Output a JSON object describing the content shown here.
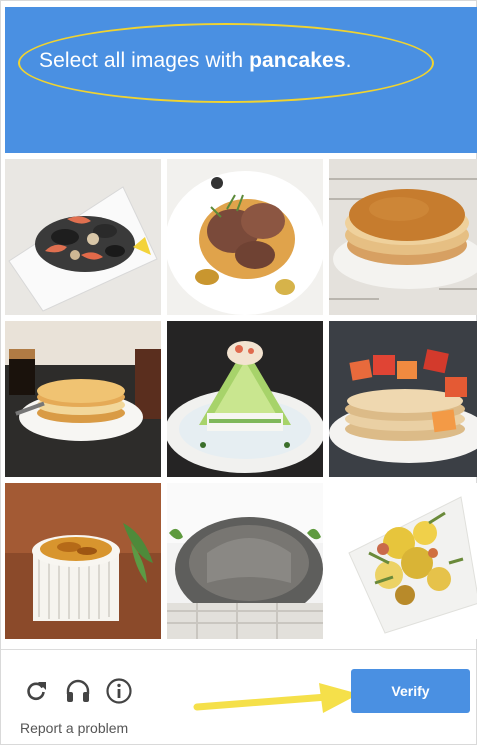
{
  "instruction": {
    "prefix": "Select all images with ",
    "target": "pancakes",
    "suffix": "."
  },
  "tiles": [
    {
      "subject": "seafood platter"
    },
    {
      "subject": "sliced meat dish"
    },
    {
      "subject": "pancakes"
    },
    {
      "subject": "pancakes with coffee"
    },
    {
      "subject": "sushi roll tower"
    },
    {
      "subject": "pancakes with fruit"
    },
    {
      "subject": "creme brulee"
    },
    {
      "subject": "stone planter"
    },
    {
      "subject": "flower bouquet"
    }
  ],
  "controls": {
    "reload_icon": "reload-icon",
    "audio_icon": "headphones-icon",
    "info_icon": "info-icon",
    "verify_label": "Verify",
    "report_label": "Report a problem"
  },
  "colors": {
    "header_bg": "#4a90e2",
    "highlight": "#f0d330",
    "arrow": "#f5e04a",
    "verify_bg": "#4a90e2"
  }
}
